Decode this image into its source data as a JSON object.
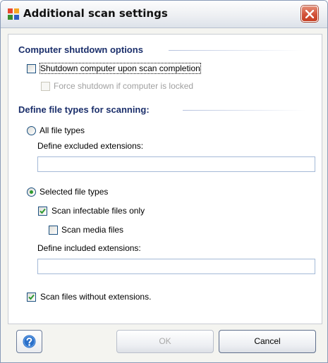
{
  "window": {
    "title": "Additional scan settings"
  },
  "shutdown": {
    "heading": "Computer shutdown options",
    "shutdown_label": "Shutdown computer upon scan completion",
    "shutdown_checked": false,
    "force_label": "Force shutdown if computer is locked",
    "force_checked": false
  },
  "filetypes": {
    "heading": "Define file types for scanning:",
    "all_label": "All file types",
    "all_selected": false,
    "excluded_label": "Define excluded extensions:",
    "excluded_value": "",
    "selected_label": "Selected file types",
    "selected_selected": true,
    "infectable_label": "Scan infectable files only",
    "infectable_checked": true,
    "media_label": "Scan media files",
    "media_checked": false,
    "included_label": "Define included extensions:",
    "included_value": "",
    "noext_label": "Scan files without extensions.",
    "noext_checked": true
  },
  "footer": {
    "ok_label": "OK",
    "cancel_label": "Cancel"
  },
  "icons": {
    "app": "avast-icon",
    "close": "close-icon",
    "help": "help-icon",
    "check": "checkmark-icon"
  },
  "colors": {
    "section_heading": "#1b2f6b",
    "check": "#2e9a30",
    "close_button": "#d2523a"
  }
}
